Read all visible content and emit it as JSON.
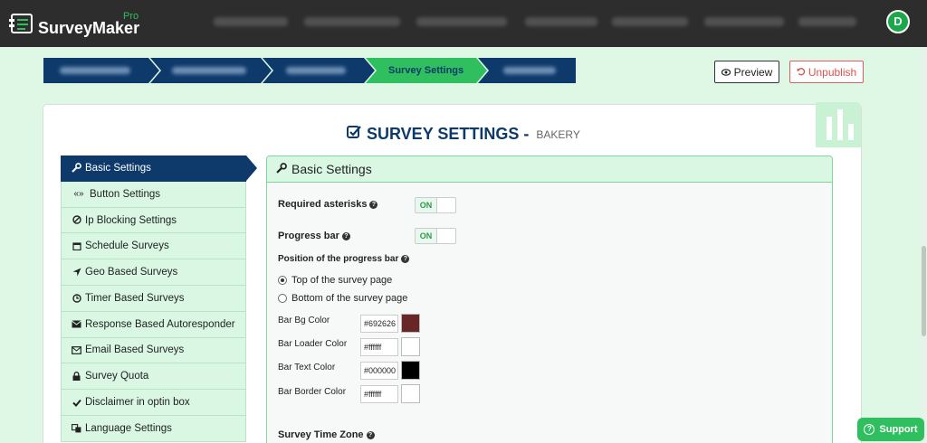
{
  "app": {
    "brand": "SurveyMaker",
    "brand_tag": "Pro",
    "avatar_initial": "D"
  },
  "stepper": {
    "active_label": "Survey Settings"
  },
  "actions": {
    "preview": "Preview",
    "unpublish": "Unpublish"
  },
  "page": {
    "title": "SURVEY SETTINGS -",
    "subtitle": "BAKERY"
  },
  "sidebar": {
    "items": [
      {
        "label": "Basic Settings",
        "icon": "wrench-icon"
      },
      {
        "label": "Button Settings",
        "icon": "double-chevron-icon"
      },
      {
        "label": "Ip Blocking Settings",
        "icon": "ban-icon"
      },
      {
        "label": "Schedule Surveys",
        "icon": "calendar-icon"
      },
      {
        "label": "Geo Based Surveys",
        "icon": "location-arrow-icon"
      },
      {
        "label": "Timer Based Surveys",
        "icon": "clock-icon"
      },
      {
        "label": "Response Based Autoresponder",
        "icon": "envelope-icon"
      },
      {
        "label": "Email Based Surveys",
        "icon": "envelope-outline-icon"
      },
      {
        "label": "Survey Quota",
        "icon": "lock-icon"
      },
      {
        "label": "Disclaimer in optin box",
        "icon": "check-icon"
      },
      {
        "label": "Language Settings",
        "icon": "language-icon"
      }
    ]
  },
  "panel": {
    "title": "Basic Settings",
    "required_asterisks": {
      "label": "Required asterisks",
      "state": "ON"
    },
    "progress_bar": {
      "label": "Progress bar",
      "state": "ON"
    },
    "position": {
      "label": "Position of the progress bar",
      "options": [
        "Top of the survey page",
        "Bottom of the survey page"
      ],
      "selected": "Top of the survey page"
    },
    "colors": [
      {
        "label": "Bar Bg Color",
        "value": "#692626"
      },
      {
        "label": "Bar Loader Color",
        "value": "#ffffff"
      },
      {
        "label": "Bar Text Color",
        "value": "#000000"
      },
      {
        "label": "Bar Border Color",
        "value": "#ffffff"
      }
    ],
    "time_zone_label": "Survey Time Zone"
  },
  "support": {
    "label": "Support"
  },
  "theme": {
    "navy": "#0e3a6b",
    "green": "#2fbf5f",
    "mint": "#d9f7e2",
    "danger": "#d9534f"
  }
}
